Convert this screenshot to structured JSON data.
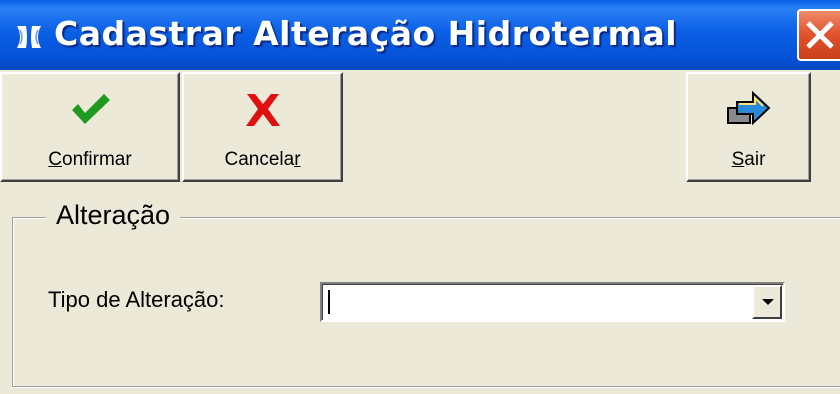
{
  "window": {
    "title": "Cadastrar Alteração Hidrotermal",
    "app_icon": "app-icon",
    "close_icon": "close-x-icon"
  },
  "toolbar": {
    "confirm": {
      "label_underlined": "C",
      "label_rest": "onfirmar",
      "icon": "check-icon",
      "icon_color": "#1e9a1e"
    },
    "cancel": {
      "label_start": "Cancela",
      "label_underlined": "r",
      "icon": "x-icon",
      "icon_color": "#e01010"
    },
    "exit": {
      "label_underlined": "S",
      "label_rest": "air",
      "icon": "exit-arrow-icon",
      "icon_color": "#2a8ad8"
    }
  },
  "group": {
    "title": "Alteração"
  },
  "form": {
    "tipo_label": "Tipo de Alteração:",
    "tipo_value": "",
    "dropdown_icon": "chevron-down-icon"
  }
}
